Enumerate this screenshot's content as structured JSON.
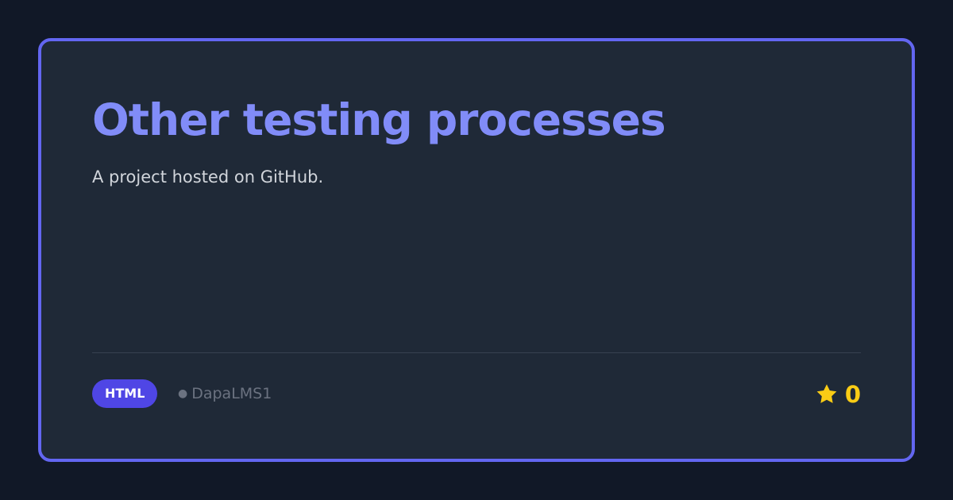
{
  "card": {
    "title": "Other testing processes",
    "description": "A project hosted on GitHub.",
    "language_badge": "HTML",
    "owner_bullet": "●",
    "owner": "DapaLMS1",
    "star_count": "0"
  },
  "icons": {
    "star": "star-icon"
  },
  "colors": {
    "background": "#111827",
    "card_background": "#1f2937",
    "card_border": "#6366f1",
    "title": "#818cf8",
    "description": "#d1d5db",
    "badge_background": "#4f46e5",
    "owner_text": "#6b7280",
    "star": "#facc15"
  }
}
